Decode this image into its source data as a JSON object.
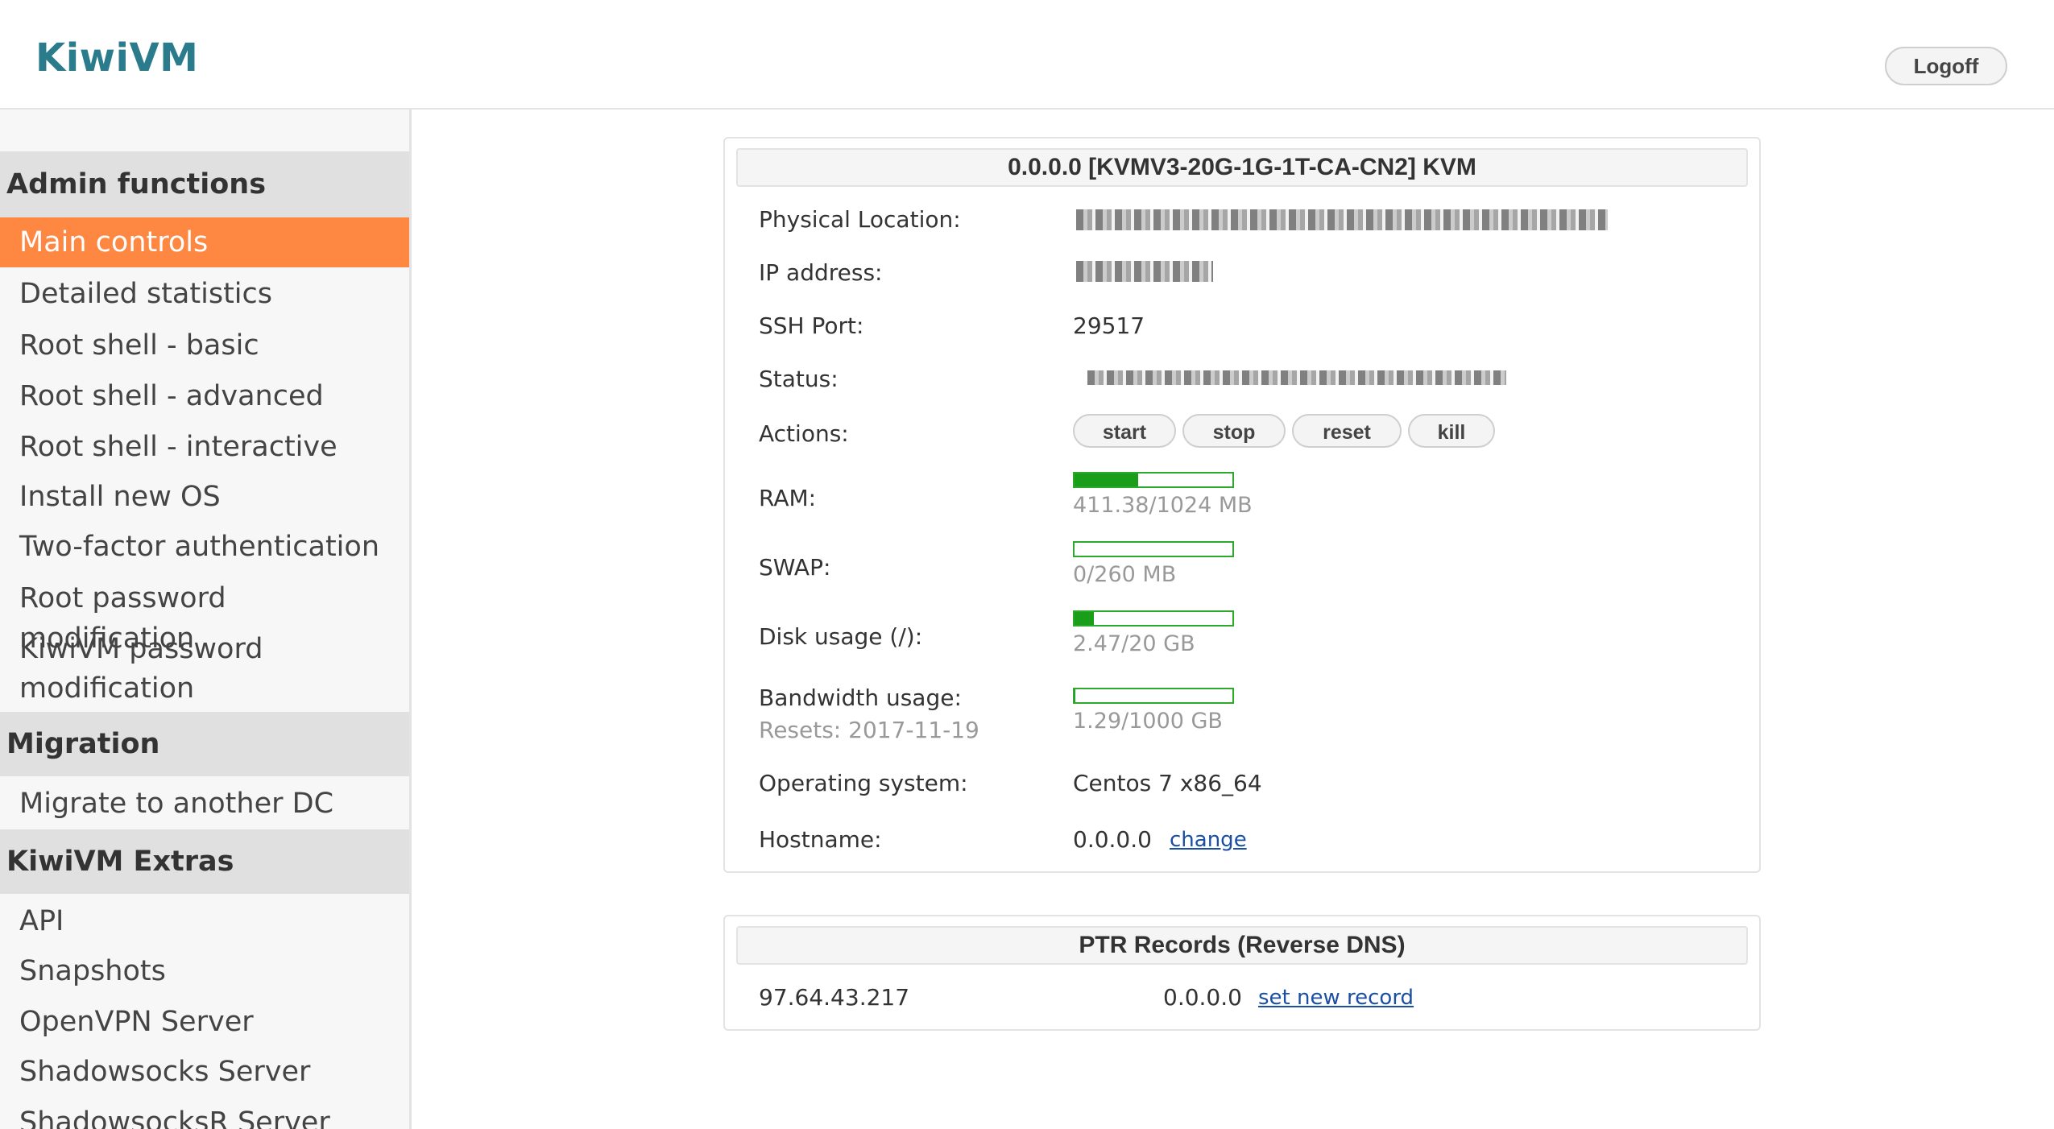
{
  "app": {
    "logo": "KiwiVM",
    "logoff_label": "Logoff"
  },
  "sidebar": {
    "sections": [
      {
        "title": "Admin functions",
        "items": [
          "Main controls",
          "Detailed statistics",
          "Root shell - basic",
          "Root shell - advanced",
          "Root shell - interactive",
          "Install new OS",
          "Two-factor authentication",
          "Root password modification",
          "KiwiVM password",
          "modification"
        ]
      },
      {
        "title": "Migration",
        "items": [
          "Migrate to another DC"
        ]
      },
      {
        "title": "KiwiVM Extras",
        "items": [
          "API",
          "Snapshots",
          "OpenVPN Server",
          "Shadowsocks Server",
          "ShadowsocksR Server"
        ]
      }
    ],
    "active_item": "Main controls"
  },
  "vps": {
    "title": "0.0.0.0   [KVMV3-20G-1G-1T-CA-CN2]   KVM",
    "labels": {
      "location": "Physical Location:",
      "ip": "IP address:",
      "ssh_port": "SSH Port:",
      "status": "Status:",
      "actions": "Actions:",
      "ram": "RAM:",
      "swap": "SWAP:",
      "disk": "Disk usage (/):",
      "bandwidth": "Bandwidth usage:",
      "bandwidth_reset": "Resets: 2017-11-19",
      "os": "Operating system:",
      "hostname": "Hostname:"
    },
    "ssh_port": "29517",
    "actions": [
      "start",
      "stop",
      "reset",
      "kill"
    ],
    "ram": {
      "text": "411.38/1024 MB",
      "fraction": 0.402
    },
    "swap": {
      "text": "0/260 MB",
      "fraction": 0.0
    },
    "disk": {
      "text": "2.47/20 GB",
      "fraction": 0.124
    },
    "bandwidth": {
      "text": "1.29/1000 GB",
      "fraction": 0.0013
    },
    "os": "Centos 7 x86_64",
    "hostname": "0.0.0.0",
    "hostname_link": "change"
  },
  "ptr": {
    "title": "PTR Records (Reverse DNS)",
    "ip": "97.64.43.217",
    "record": "0.0.0.0",
    "link": "set new record"
  },
  "colors": {
    "accent": "#fe8742",
    "bar": "#1a9e1a",
    "logo": "#2a7b8c",
    "link": "#1a4fa3"
  }
}
